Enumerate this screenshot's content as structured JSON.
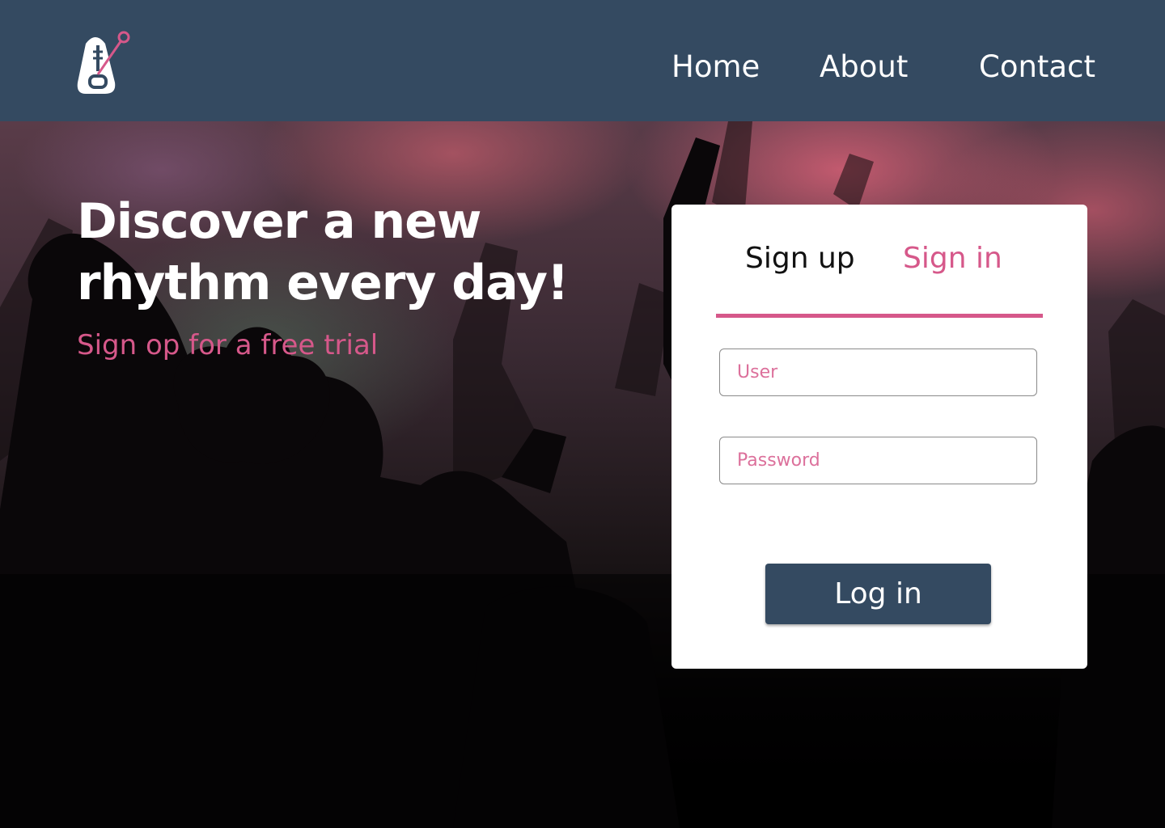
{
  "header": {
    "logo_icon": "metronome-icon",
    "nav": {
      "home": "Home",
      "about": "About",
      "contact": "Contact"
    }
  },
  "hero": {
    "headline": "Discover a new rhythm every day!",
    "subline": "Sign op for a free trial"
  },
  "auth_card": {
    "tabs": {
      "signup": "Sign up",
      "signin": "Sign in"
    },
    "active_tab": "Sign in",
    "user_placeholder": "User",
    "user_value": "",
    "password_placeholder": "Password",
    "password_value": "",
    "login_label": "Log in"
  },
  "colors": {
    "header_bg": "#344a61",
    "accent_pink": "#d6588a",
    "card_bg": "#ffffff",
    "button_bg": "#344a61"
  }
}
